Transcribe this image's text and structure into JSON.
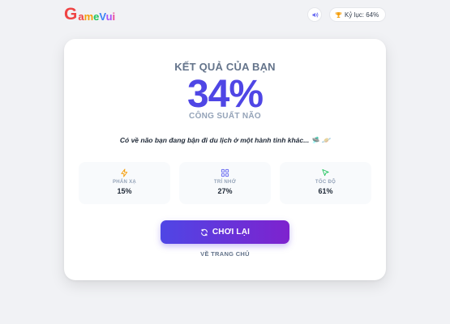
{
  "app": {
    "logo_first": "G",
    "logo_rest": [
      "a",
      "m",
      "e",
      "V",
      "u",
      "i"
    ]
  },
  "header": {
    "sound_icon": "speaker-icon",
    "record_icon": "trophy-icon",
    "record_text": "Kỷ lục: 64%"
  },
  "result": {
    "title": "KẾT QUẢ CỦA BẠN",
    "score": "34%",
    "level": "CÔNG SUẤT NÃO",
    "comment": "Có về não bạn đang bận đi du lịch ở một hành tinh khác... 🛸 🪐"
  },
  "stats": [
    {
      "icon": "lightning-icon",
      "label": "PHẢN XẠ",
      "value": "15%",
      "color": "#f59e0b"
    },
    {
      "icon": "grid-icon",
      "label": "TRÍ NHỚ",
      "value": "27%",
      "color": "#6366f1"
    },
    {
      "icon": "cursor-icon",
      "label": "TỐC ĐỘ",
      "value": "61%",
      "color": "#22c55e"
    }
  ],
  "actions": {
    "replay_icon": "refresh-icon",
    "replay_label": "CHƠI LẠI",
    "home_label": "VỀ TRANG CHỦ"
  },
  "colors": {
    "accent": "#4f46e5",
    "accent_end": "#7e22ce",
    "background": "#f1f2f5"
  }
}
